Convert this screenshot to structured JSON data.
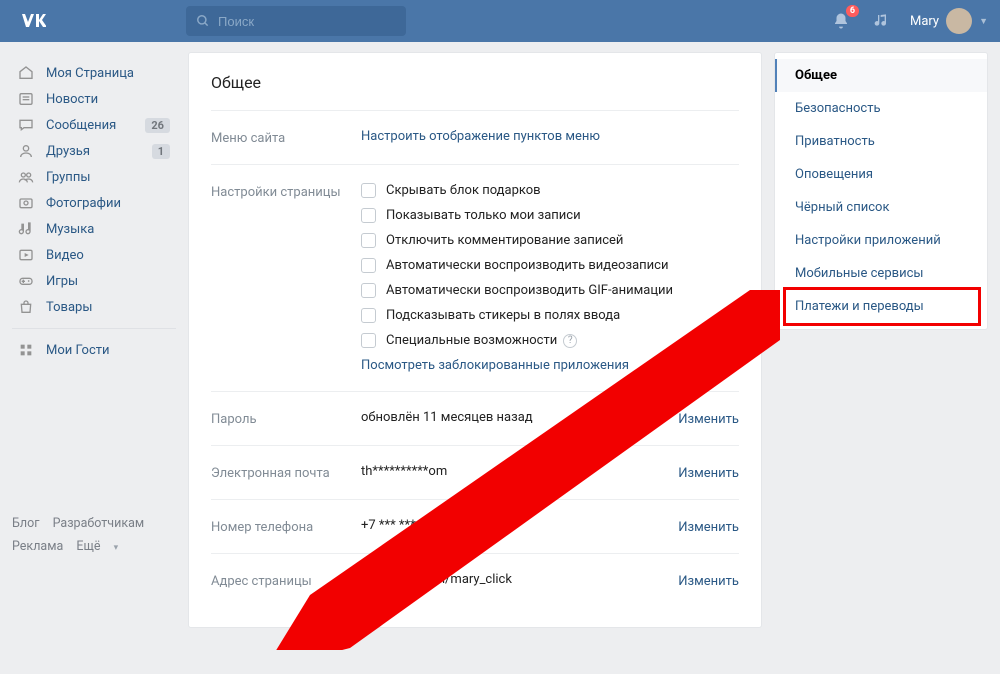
{
  "header": {
    "search_placeholder": "Поиск",
    "notif_count": "6",
    "user_name": "Mary"
  },
  "left_nav": [
    {
      "icon": "home",
      "label": "Моя Страница"
    },
    {
      "icon": "news",
      "label": "Новости"
    },
    {
      "icon": "msg",
      "label": "Сообщения",
      "badge": "26"
    },
    {
      "icon": "friends",
      "label": "Друзья",
      "badge": "1"
    },
    {
      "icon": "groups",
      "label": "Группы"
    },
    {
      "icon": "photo",
      "label": "Фотографии"
    },
    {
      "icon": "music",
      "label": "Музыка"
    },
    {
      "icon": "video",
      "label": "Видео"
    },
    {
      "icon": "games",
      "label": "Игры"
    },
    {
      "icon": "market",
      "label": "Товары"
    }
  ],
  "left_nav_extra": {
    "icon": "apps",
    "label": "Мои Гости"
  },
  "footer": {
    "a": "Блог",
    "b": "Разработчикам",
    "c": "Реклама",
    "d": "Ещё"
  },
  "page_title": "Общее",
  "menu_section": {
    "label": "Меню сайта",
    "link": "Настроить отображение пунктов меню"
  },
  "page_settings": {
    "label": "Настройки страницы",
    "checks": [
      "Скрывать блок подарков",
      "Показывать только мои записи",
      "Отключить комментирование записей",
      "Автоматически воспроизводить видеозаписи",
      "Автоматически воспроизводить GIF-анимации",
      "Подсказывать стикеры в полях ввода",
      "Специальные возможности"
    ],
    "blocked_link": "Посмотреть заблокированные приложения"
  },
  "rows": [
    {
      "label": "Пароль",
      "value": "обновлён 11 месяцев назад",
      "action": "Изменить"
    },
    {
      "label": "Электронная почта",
      "value": "th**********om",
      "action": "Изменить"
    },
    {
      "label": "Номер телефона",
      "value": "+7 *** *** ** 15",
      "action": "Изменить"
    },
    {
      "label": "Адрес страницы",
      "value": "https://vk.com/mary_click",
      "action": "Изменить"
    }
  ],
  "right_tabs": [
    "Общее",
    "Безопасность",
    "Приватность",
    "Оповещения",
    "Чёрный список",
    "Настройки приложений",
    "Мобильные сервисы",
    "Платежи и переводы"
  ]
}
